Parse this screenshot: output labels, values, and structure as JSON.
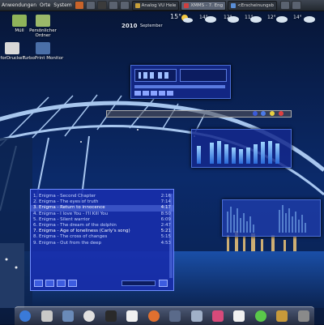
{
  "panel": {
    "menus": [
      "Anwendungen",
      "Orte",
      "System"
    ],
    "tasks": [
      {
        "label": "Analog VU Hele",
        "active": false
      },
      {
        "label": "XMMS - 7. Eng",
        "active": true
      },
      {
        "label": "<Erscheinungsb",
        "active": false
      }
    ]
  },
  "desktop_icons": [
    {
      "label": "Müll",
      "icon": "trash-icon"
    },
    {
      "label": "Persönlicher Ordner",
      "icon": "home-folder-icon"
    },
    {
      "label": "forDrucker",
      "icon": "printer-icon"
    },
    {
      "label": "TurboPrint Monitor",
      "icon": "turboprint-icon"
    }
  ],
  "weather": {
    "year": "2010",
    "month": "September",
    "temps": [
      "15°",
      "14°",
      "12°",
      "11°",
      "12°",
      "14°"
    ]
  },
  "playlist": {
    "tracks": [
      {
        "title": "1. Enigma - Second Chapter",
        "time": "2:16"
      },
      {
        "title": "2. Enigma - The eyes of truth",
        "time": "7:14"
      },
      {
        "title": "3. Enigma - Return to innocence",
        "time": "4:17"
      },
      {
        "title": "4. Enigma - I love You - I'll Kill You",
        "time": "8:50"
      },
      {
        "title": "5. Enigma - Silent warrior",
        "time": "6:09"
      },
      {
        "title": "6. Enigma - The dream of the dolphin",
        "time": "2:47"
      },
      {
        "title": "7. Enigma - Age of loneliness (Carly's song)",
        "time": "5:21"
      },
      {
        "title": "8. Enigma - The cross of changes",
        "time": "5:15"
      },
      {
        "title": "9. Enigma - Out from the deep",
        "time": "4:53"
      }
    ],
    "selected_index": 2,
    "current_index": 6,
    "buttons": [
      "+",
      "-",
      "sel",
      "misc",
      "list"
    ]
  },
  "colors": {
    "player_bg": "#1e3cb0",
    "accent": "#6e8dff",
    "panel": "#2a3038"
  }
}
